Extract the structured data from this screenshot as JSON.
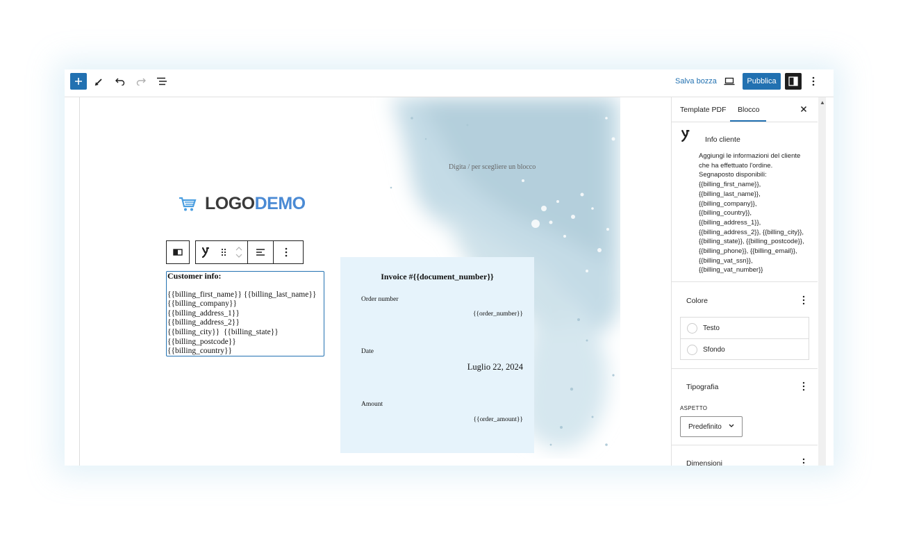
{
  "toolbar": {
    "save_draft_label": "Salva bozza",
    "publish_label": "Pubblica"
  },
  "canvas": {
    "placeholder": "Digita / per scegliere un blocco",
    "logo": {
      "part_a": "LOGO",
      "part_b": "DEMO"
    },
    "customer_block": {
      "title": "Customer info:",
      "lines": [
        "{{billing_first_name}} {{billing_last_name}}",
        "{{billing_company}}",
        "{{billing_address_1}}",
        "{{billing_address_2}}",
        "{{billing_city}}  {{billing_state}}",
        "{{billing_postcode}}",
        "{{billing_country}}"
      ]
    },
    "invoice": {
      "title": "Invoice #{{document_number}}",
      "order_number_label": "Order number",
      "order_number_value": "{{order_number}}",
      "date_label": "Date",
      "date_value": "Luglio 22, 2024",
      "amount_label": "Amount",
      "amount_value": "{{order_amount}}"
    }
  },
  "sidebar": {
    "tabs": [
      {
        "label": "Template PDF"
      },
      {
        "label": "Blocco"
      }
    ],
    "block": {
      "title": "Info cliente",
      "description_lines": [
        "Aggiungi le informazioni del cliente",
        "che ha effettuato l'ordine.",
        "Segnaposto disponibili:",
        "{{billing_first_name}},",
        "{{billing_last_name}},",
        "{{billing_company}},",
        "{{billing_country}},",
        "{{billing_address_1}},",
        "{{billing_address_2}}, {{billing_city}},",
        "{{billing_state}}, {{billing_postcode}},",
        "{{billing_phone}}, {{billing_email}},",
        "{{billing_vat_ssn}},",
        "{{billing_vat_number}}"
      ]
    },
    "color_panel": {
      "title": "Colore",
      "text_label": "Testo",
      "background_label": "Sfondo"
    },
    "typography_panel": {
      "title": "Tipografia",
      "aspect_label": "ASPETTO",
      "aspect_value": "Predefinito"
    },
    "dimensions_panel": {
      "title": "Dimensioni"
    }
  },
  "colors": {
    "accent": "#2271b1",
    "invoice_bg": "#e6f3fb",
    "logo_dark": "#3a3a3a",
    "logo_blue": "#4a8ad4"
  }
}
